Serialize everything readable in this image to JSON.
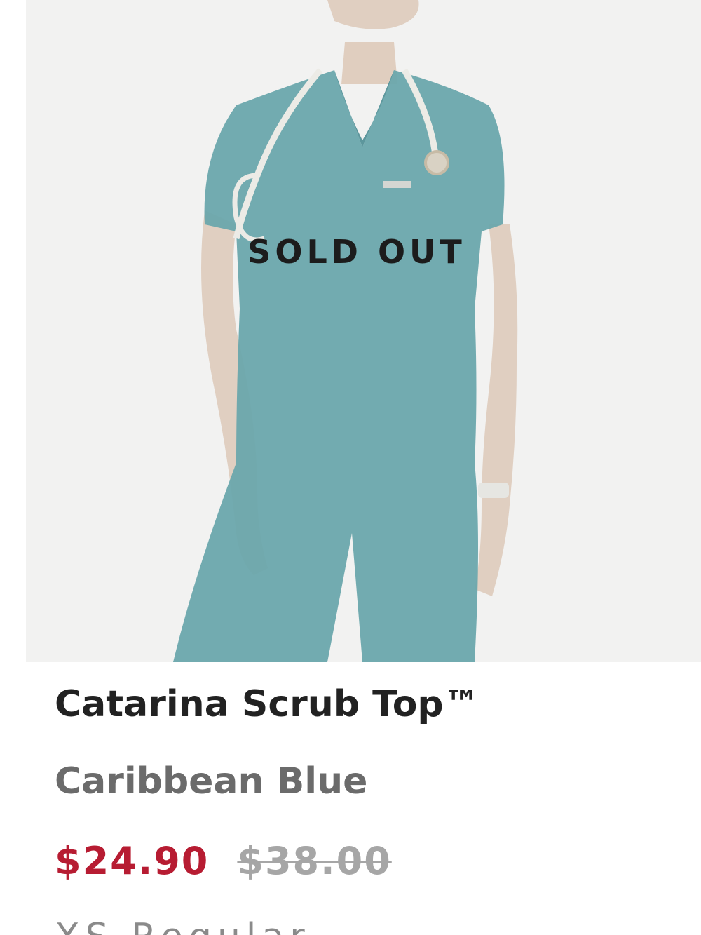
{
  "product": {
    "sold_out_label": "SOLD OUT",
    "name": "Catarina Scrub Top™",
    "color": "Caribbean Blue",
    "price_sale": "$24.90",
    "price_original": "$38.00",
    "size": "XS Regular"
  },
  "colors": {
    "sale_price": "#b71c32",
    "scrub": "#2f8a92"
  },
  "icons": {
    "product_photo": "scrub-top-photo"
  }
}
